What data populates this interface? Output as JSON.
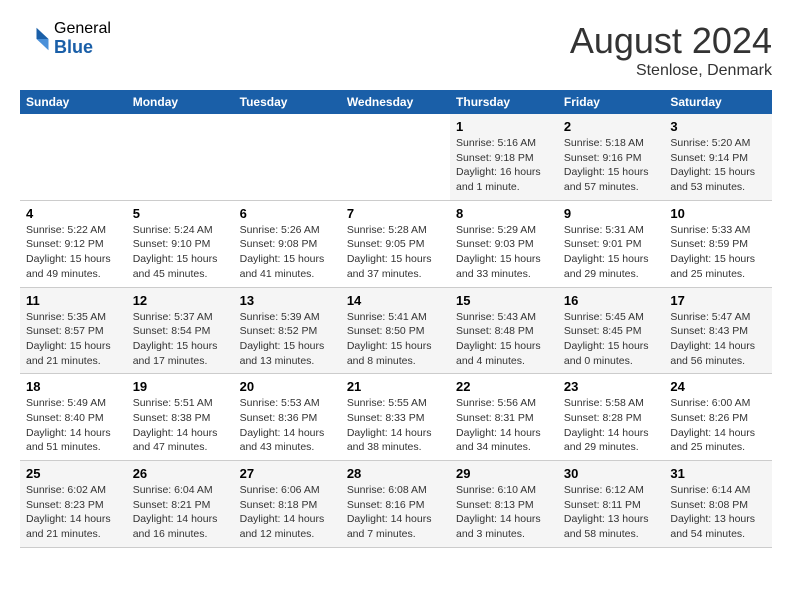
{
  "logo": {
    "general": "General",
    "blue": "Blue"
  },
  "title": "August 2024",
  "subtitle": "Stenlose, Denmark",
  "days_of_week": [
    "Sunday",
    "Monday",
    "Tuesday",
    "Wednesday",
    "Thursday",
    "Friday",
    "Saturday"
  ],
  "weeks": [
    [
      {
        "day": "",
        "info": ""
      },
      {
        "day": "",
        "info": ""
      },
      {
        "day": "",
        "info": ""
      },
      {
        "day": "",
        "info": ""
      },
      {
        "day": "1",
        "info": "Sunrise: 5:16 AM\nSunset: 9:18 PM\nDaylight: 16 hours\nand 1 minute."
      },
      {
        "day": "2",
        "info": "Sunrise: 5:18 AM\nSunset: 9:16 PM\nDaylight: 15 hours\nand 57 minutes."
      },
      {
        "day": "3",
        "info": "Sunrise: 5:20 AM\nSunset: 9:14 PM\nDaylight: 15 hours\nand 53 minutes."
      }
    ],
    [
      {
        "day": "4",
        "info": "Sunrise: 5:22 AM\nSunset: 9:12 PM\nDaylight: 15 hours\nand 49 minutes."
      },
      {
        "day": "5",
        "info": "Sunrise: 5:24 AM\nSunset: 9:10 PM\nDaylight: 15 hours\nand 45 minutes."
      },
      {
        "day": "6",
        "info": "Sunrise: 5:26 AM\nSunset: 9:08 PM\nDaylight: 15 hours\nand 41 minutes."
      },
      {
        "day": "7",
        "info": "Sunrise: 5:28 AM\nSunset: 9:05 PM\nDaylight: 15 hours\nand 37 minutes."
      },
      {
        "day": "8",
        "info": "Sunrise: 5:29 AM\nSunset: 9:03 PM\nDaylight: 15 hours\nand 33 minutes."
      },
      {
        "day": "9",
        "info": "Sunrise: 5:31 AM\nSunset: 9:01 PM\nDaylight: 15 hours\nand 29 minutes."
      },
      {
        "day": "10",
        "info": "Sunrise: 5:33 AM\nSunset: 8:59 PM\nDaylight: 15 hours\nand 25 minutes."
      }
    ],
    [
      {
        "day": "11",
        "info": "Sunrise: 5:35 AM\nSunset: 8:57 PM\nDaylight: 15 hours\nand 21 minutes."
      },
      {
        "day": "12",
        "info": "Sunrise: 5:37 AM\nSunset: 8:54 PM\nDaylight: 15 hours\nand 17 minutes."
      },
      {
        "day": "13",
        "info": "Sunrise: 5:39 AM\nSunset: 8:52 PM\nDaylight: 15 hours\nand 13 minutes."
      },
      {
        "day": "14",
        "info": "Sunrise: 5:41 AM\nSunset: 8:50 PM\nDaylight: 15 hours\nand 8 minutes."
      },
      {
        "day": "15",
        "info": "Sunrise: 5:43 AM\nSunset: 8:48 PM\nDaylight: 15 hours\nand 4 minutes."
      },
      {
        "day": "16",
        "info": "Sunrise: 5:45 AM\nSunset: 8:45 PM\nDaylight: 15 hours\nand 0 minutes."
      },
      {
        "day": "17",
        "info": "Sunrise: 5:47 AM\nSunset: 8:43 PM\nDaylight: 14 hours\nand 56 minutes."
      }
    ],
    [
      {
        "day": "18",
        "info": "Sunrise: 5:49 AM\nSunset: 8:40 PM\nDaylight: 14 hours\nand 51 minutes."
      },
      {
        "day": "19",
        "info": "Sunrise: 5:51 AM\nSunset: 8:38 PM\nDaylight: 14 hours\nand 47 minutes."
      },
      {
        "day": "20",
        "info": "Sunrise: 5:53 AM\nSunset: 8:36 PM\nDaylight: 14 hours\nand 43 minutes."
      },
      {
        "day": "21",
        "info": "Sunrise: 5:55 AM\nSunset: 8:33 PM\nDaylight: 14 hours\nand 38 minutes."
      },
      {
        "day": "22",
        "info": "Sunrise: 5:56 AM\nSunset: 8:31 PM\nDaylight: 14 hours\nand 34 minutes."
      },
      {
        "day": "23",
        "info": "Sunrise: 5:58 AM\nSunset: 8:28 PM\nDaylight: 14 hours\nand 29 minutes."
      },
      {
        "day": "24",
        "info": "Sunrise: 6:00 AM\nSunset: 8:26 PM\nDaylight: 14 hours\nand 25 minutes."
      }
    ],
    [
      {
        "day": "25",
        "info": "Sunrise: 6:02 AM\nSunset: 8:23 PM\nDaylight: 14 hours\nand 21 minutes."
      },
      {
        "day": "26",
        "info": "Sunrise: 6:04 AM\nSunset: 8:21 PM\nDaylight: 14 hours\nand 16 minutes."
      },
      {
        "day": "27",
        "info": "Sunrise: 6:06 AM\nSunset: 8:18 PM\nDaylight: 14 hours\nand 12 minutes."
      },
      {
        "day": "28",
        "info": "Sunrise: 6:08 AM\nSunset: 8:16 PM\nDaylight: 14 hours\nand 7 minutes."
      },
      {
        "day": "29",
        "info": "Sunrise: 6:10 AM\nSunset: 8:13 PM\nDaylight: 14 hours\nand 3 minutes."
      },
      {
        "day": "30",
        "info": "Sunrise: 6:12 AM\nSunset: 8:11 PM\nDaylight: 13 hours\nand 58 minutes."
      },
      {
        "day": "31",
        "info": "Sunrise: 6:14 AM\nSunset: 8:08 PM\nDaylight: 13 hours\nand 54 minutes."
      }
    ]
  ]
}
